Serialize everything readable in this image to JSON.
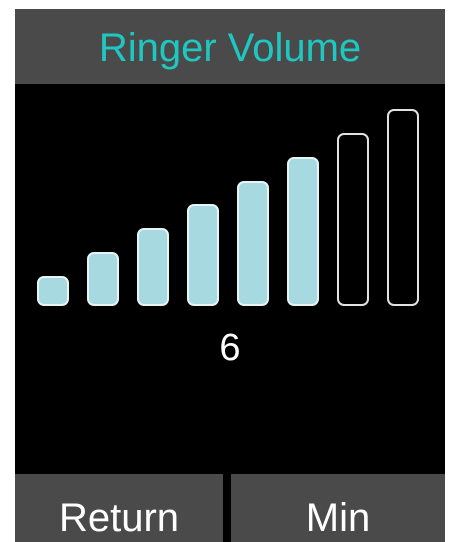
{
  "title": "Ringer Volume",
  "volume": {
    "level": 6,
    "max": 8,
    "display": "6"
  },
  "softkeys": {
    "left": "Return",
    "right": "Min"
  },
  "colors": {
    "title_text": "#1ec8c0",
    "bar_filled": "#a7d9e1",
    "bar_outline": "#e2e2e2",
    "bar_background": "#4a4a4a",
    "screen": "#000000"
  }
}
